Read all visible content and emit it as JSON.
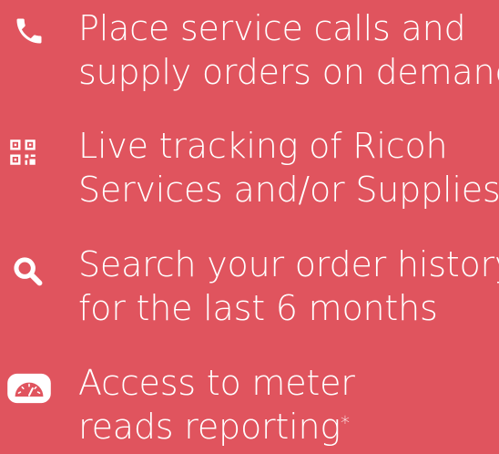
{
  "features": [
    {
      "icon": "phone-icon",
      "lines": [
        "Place service calls and",
        "supply orders on demand"
      ]
    },
    {
      "icon": "qr-code-icon",
      "lines": [
        "Live tracking of Ricoh",
        "Services and/or Supplies"
      ]
    },
    {
      "icon": "search-icon",
      "lines": [
        "Search your order history",
        "for the last 6 months"
      ]
    },
    {
      "icon": "meter-gauge-icon",
      "lines": [
        "Access to meter",
        "reads reporting"
      ],
      "footnote_mark": "*"
    }
  ],
  "colors": {
    "background": "#e0545e",
    "text": "#ffffff"
  }
}
